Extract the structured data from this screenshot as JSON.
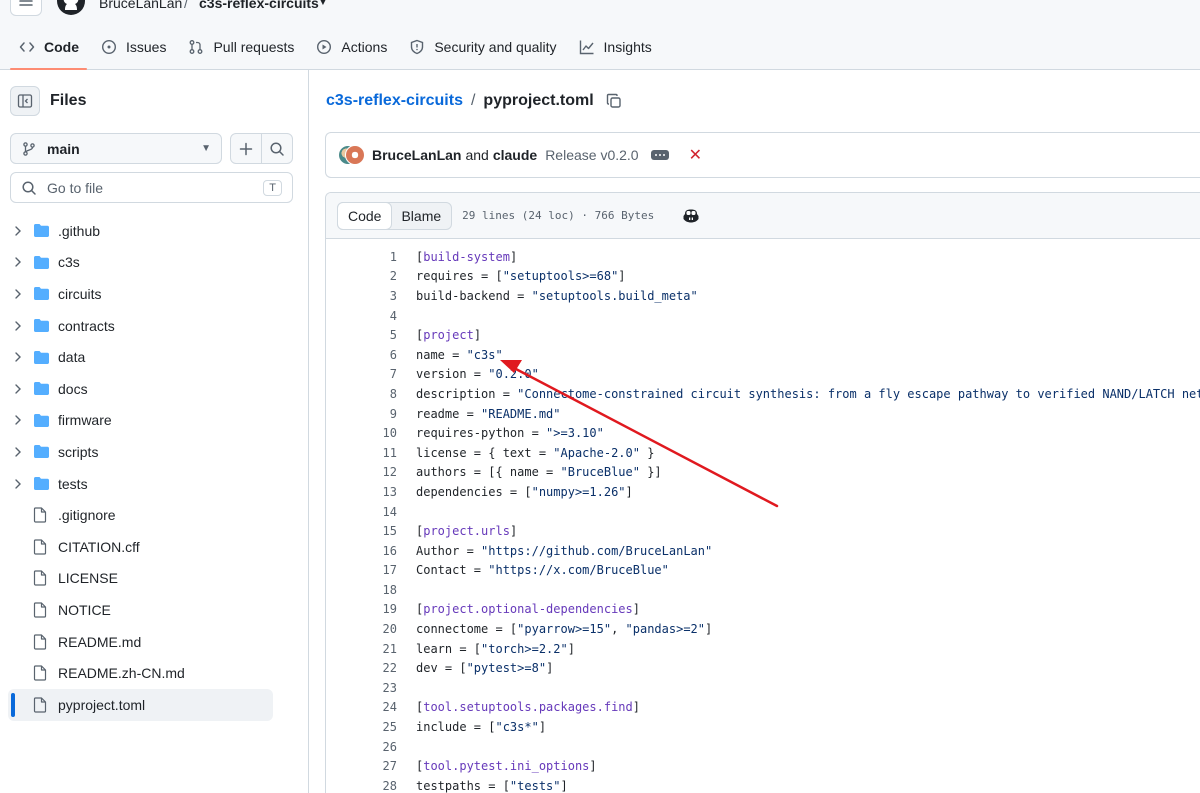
{
  "header": {
    "owner": "BruceLanLan",
    "separator": "/",
    "repo": "c3s-reflex-circuits",
    "tabs": [
      {
        "label": "Code",
        "icon": "code-icon",
        "active": true
      },
      {
        "label": "Issues",
        "icon": "issue-icon",
        "active": false
      },
      {
        "label": "Pull requests",
        "icon": "pull-request-icon",
        "active": false
      },
      {
        "label": "Actions",
        "icon": "play-icon",
        "active": false
      },
      {
        "label": "Security and quality",
        "icon": "shield-icon",
        "active": false
      },
      {
        "label": "Insights",
        "icon": "graph-icon",
        "active": false
      }
    ]
  },
  "sidebar": {
    "title": "Files",
    "branch": "main",
    "goto_placeholder": "Go to file",
    "goto_shortcut": "T",
    "items": [
      {
        "name": ".github",
        "type": "folder"
      },
      {
        "name": "c3s",
        "type": "folder"
      },
      {
        "name": "circuits",
        "type": "folder"
      },
      {
        "name": "contracts",
        "type": "folder"
      },
      {
        "name": "data",
        "type": "folder"
      },
      {
        "name": "docs",
        "type": "folder"
      },
      {
        "name": "firmware",
        "type": "folder"
      },
      {
        "name": "scripts",
        "type": "folder"
      },
      {
        "name": "tests",
        "type": "folder"
      },
      {
        "name": ".gitignore",
        "type": "file"
      },
      {
        "name": "CITATION.cff",
        "type": "file"
      },
      {
        "name": "LICENSE",
        "type": "file"
      },
      {
        "name": "NOTICE",
        "type": "file"
      },
      {
        "name": "README.md",
        "type": "file"
      },
      {
        "name": "README.zh-CN.md",
        "type": "file"
      },
      {
        "name": "pyproject.toml",
        "type": "file",
        "selected": true
      }
    ]
  },
  "main": {
    "repo_link": "c3s-reflex-circuits",
    "path_separator": "/",
    "file_name": "pyproject.toml",
    "commit": {
      "author1": "BruceLanLan",
      "and": "and",
      "author2": "claude",
      "message": "Release v0.2.0"
    },
    "view_tabs": {
      "code": "Code",
      "blame": "Blame"
    },
    "file_meta": "29 lines (24 loc) · 766 Bytes",
    "lines": [
      {
        "n": "1",
        "t": "[build-system]",
        "k": "sec"
      },
      {
        "n": "2",
        "t": "requires = [\"setuptools>=68\"]",
        "k": "kv"
      },
      {
        "n": "3",
        "t": "build-backend = \"setuptools.build_meta\"",
        "k": "kv"
      },
      {
        "n": "4",
        "t": "",
        "k": "kv"
      },
      {
        "n": "5",
        "t": "[project]",
        "k": "sec"
      },
      {
        "n": "6",
        "t": "name = \"c3s\"",
        "k": "kv"
      },
      {
        "n": "7",
        "t": "version = \"0.2.0\"",
        "k": "kv"
      },
      {
        "n": "8",
        "t": "description = \"Connectome-constrained circuit synthesis: from a fly escape pathway to verified NAND/LATCH netlists\"",
        "k": "kv"
      },
      {
        "n": "9",
        "t": "readme = \"README.md\"",
        "k": "kv"
      },
      {
        "n": "10",
        "t": "requires-python = \">=3.10\"",
        "k": "kv"
      },
      {
        "n": "11",
        "t": "license = { text = \"Apache-2.0\" }",
        "k": "kv"
      },
      {
        "n": "12",
        "t": "authors = [{ name = \"BruceBlue\" }]",
        "k": "kv"
      },
      {
        "n": "13",
        "t": "dependencies = [\"numpy>=1.26\"]",
        "k": "kv"
      },
      {
        "n": "14",
        "t": "",
        "k": "kv"
      },
      {
        "n": "15",
        "t": "[project.urls]",
        "k": "sec"
      },
      {
        "n": "16",
        "t": "Author = \"https://github.com/BruceLanLan\"",
        "k": "kv"
      },
      {
        "n": "17",
        "t": "Contact = \"https://x.com/BruceBlue\"",
        "k": "kv"
      },
      {
        "n": "18",
        "t": "",
        "k": "kv"
      },
      {
        "n": "19",
        "t": "[project.optional-dependencies]",
        "k": "sec"
      },
      {
        "n": "20",
        "t": "connectome = [\"pyarrow>=15\", \"pandas>=2\"]",
        "k": "kv"
      },
      {
        "n": "21",
        "t": "learn = [\"torch>=2.2\"]",
        "k": "kv"
      },
      {
        "n": "22",
        "t": "dev = [\"pytest>=8\"]",
        "k": "kv"
      },
      {
        "n": "23",
        "t": "",
        "k": "kv"
      },
      {
        "n": "24",
        "t": "[tool.setuptools.packages.find]",
        "k": "sec"
      },
      {
        "n": "25",
        "t": "include = [\"c3s*\"]",
        "k": "kv"
      },
      {
        "n": "26",
        "t": "",
        "k": "kv"
      },
      {
        "n": "27",
        "t": "[tool.pytest.ini_options]",
        "k": "sec"
      },
      {
        "n": "28",
        "t": "testpaths = [\"tests\"]",
        "k": "kv"
      }
    ]
  },
  "colors": {
    "accent": "#0969da",
    "active_tab_underline": "#fd8c73",
    "folder": "#54aeff",
    "annotation_arrow": "#e0191f",
    "fail": "#d1242f"
  }
}
